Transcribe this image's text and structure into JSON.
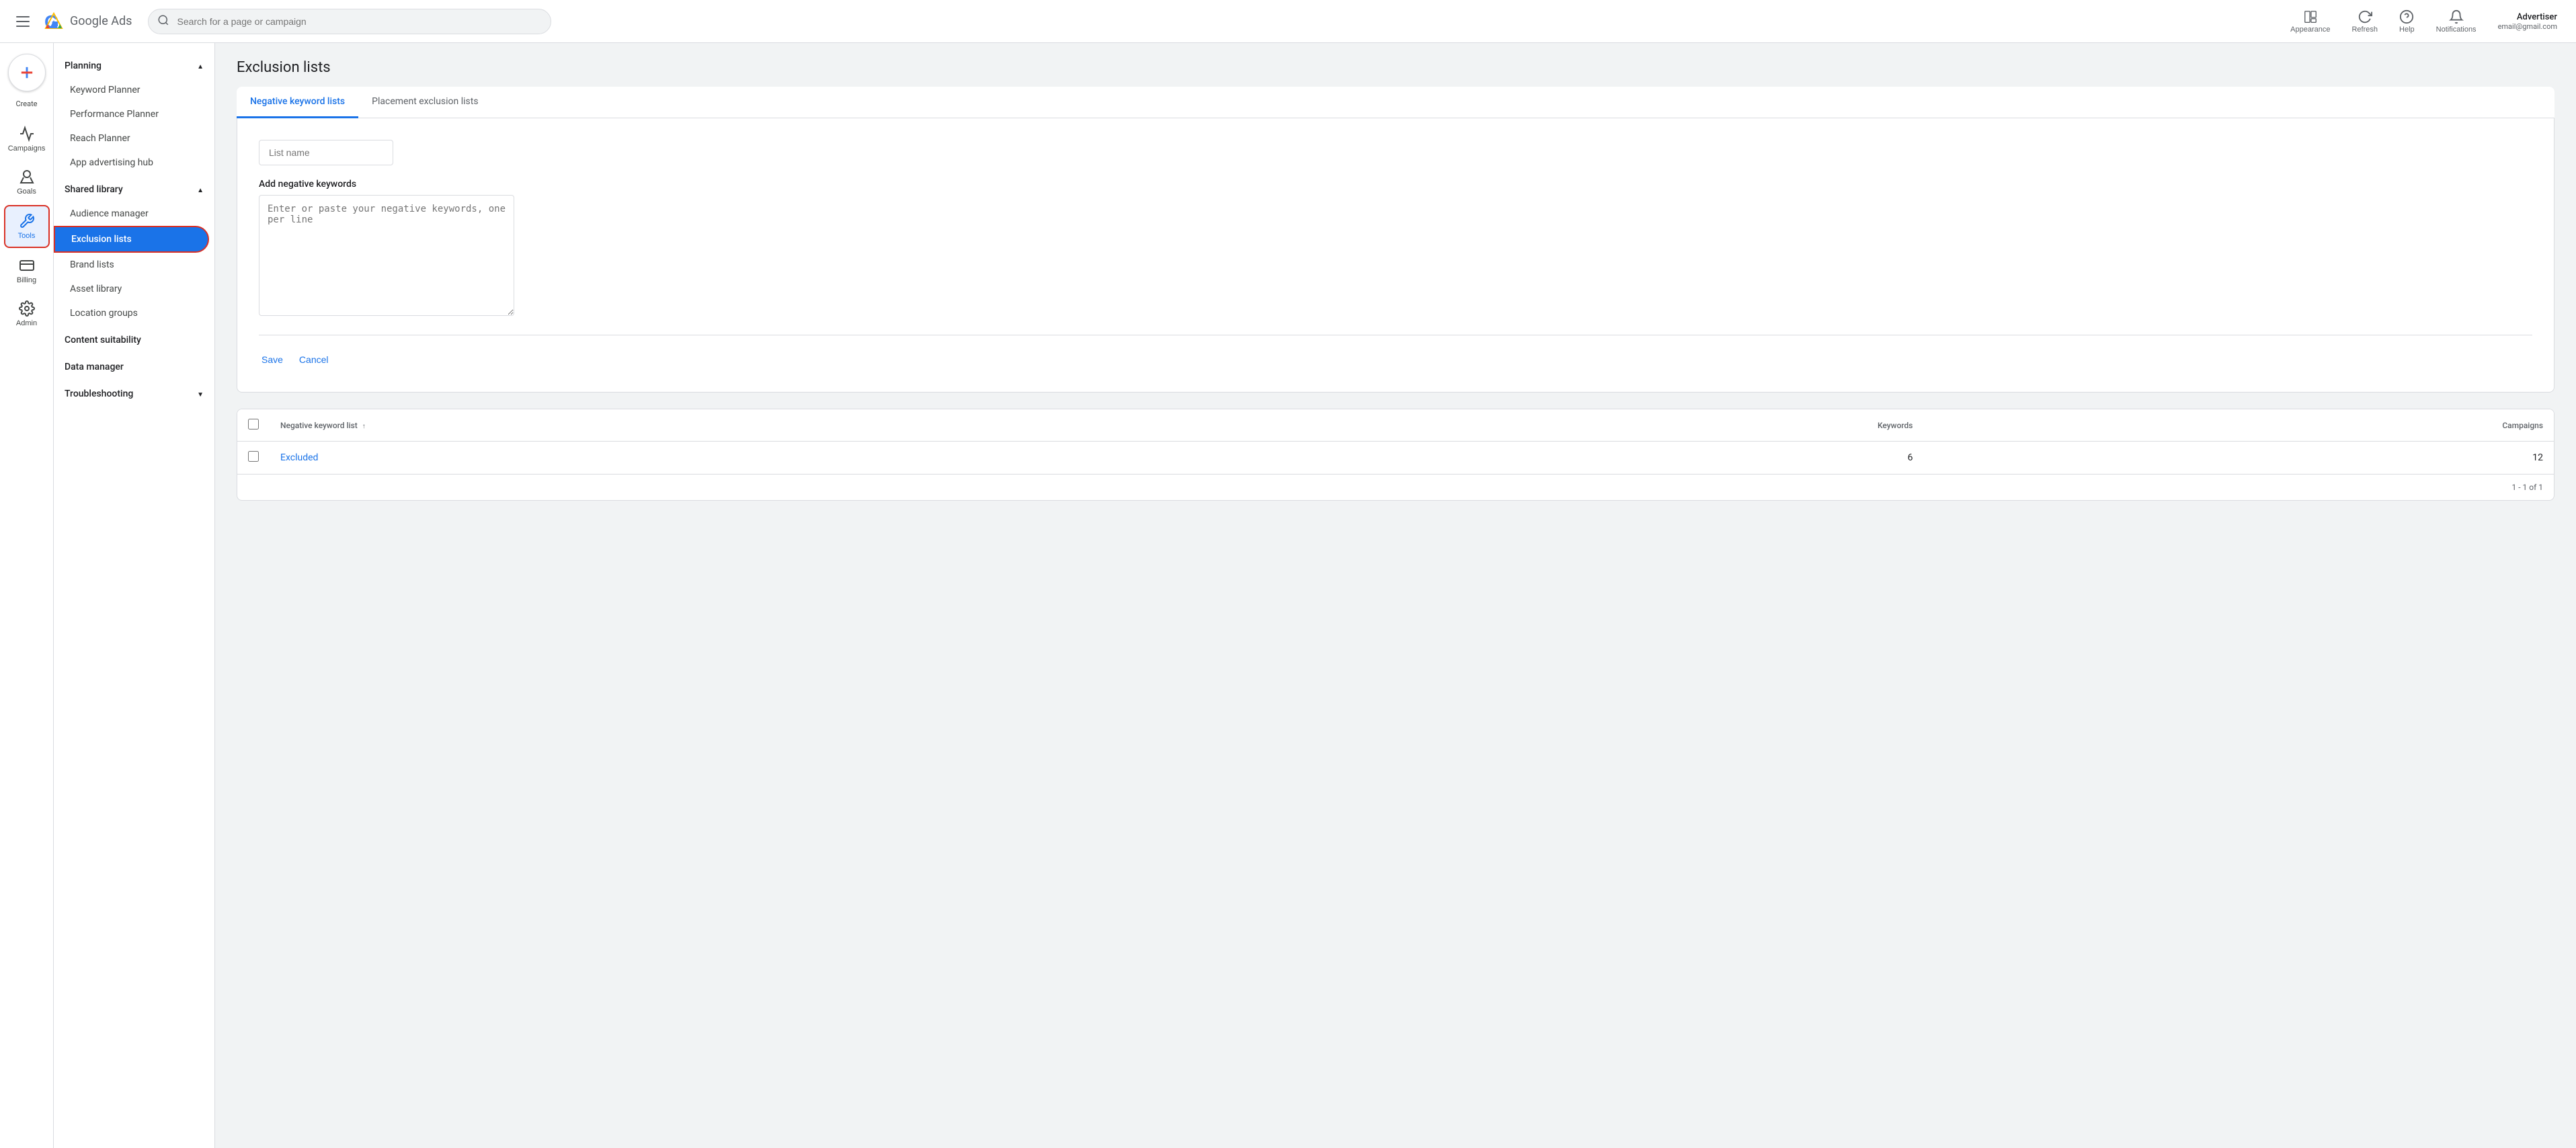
{
  "topbar": {
    "search_placeholder": "Search for a page or campaign",
    "logo_text": "Google Ads",
    "actions": [
      {
        "id": "appearance",
        "label": "Appearance"
      },
      {
        "id": "refresh",
        "label": "Refresh"
      },
      {
        "id": "help",
        "label": "Help"
      },
      {
        "id": "notifications",
        "label": "Notifications"
      }
    ],
    "advertiser_name": "Advertiser",
    "advertiser_email": "email@gmail.com"
  },
  "icon_sidebar": {
    "create_label": "Create",
    "items": [
      {
        "id": "campaigns",
        "label": "Campaigns"
      },
      {
        "id": "goals",
        "label": "Goals"
      },
      {
        "id": "tools",
        "label": "Tools",
        "active": true
      },
      {
        "id": "billing",
        "label": "Billing"
      },
      {
        "id": "admin",
        "label": "Admin"
      }
    ]
  },
  "nav_sidebar": {
    "sections": [
      {
        "id": "planning",
        "label": "Planning",
        "expanded": true,
        "items": [
          {
            "id": "keyword-planner",
            "label": "Keyword Planner"
          },
          {
            "id": "performance-planner",
            "label": "Performance Planner"
          },
          {
            "id": "reach-planner",
            "label": "Reach Planner"
          },
          {
            "id": "app-advertising-hub",
            "label": "App advertising hub"
          }
        ]
      },
      {
        "id": "shared-library",
        "label": "Shared library",
        "expanded": true,
        "items": [
          {
            "id": "audience-manager",
            "label": "Audience manager"
          },
          {
            "id": "exclusion-lists",
            "label": "Exclusion lists",
            "active": true
          },
          {
            "id": "brand-lists",
            "label": "Brand lists"
          },
          {
            "id": "asset-library",
            "label": "Asset library"
          },
          {
            "id": "location-groups",
            "label": "Location groups"
          }
        ]
      },
      {
        "id": "content-suitability",
        "label": "Content suitability",
        "expanded": false,
        "items": []
      },
      {
        "id": "data-manager",
        "label": "Data manager",
        "expanded": false,
        "items": []
      },
      {
        "id": "troubleshooting",
        "label": "Troubleshooting",
        "expanded": false,
        "items": []
      }
    ]
  },
  "main": {
    "page_title": "Exclusion lists",
    "tabs": [
      {
        "id": "negative-keyword-lists",
        "label": "Negative keyword lists",
        "active": true
      },
      {
        "id": "placement-exclusion-lists",
        "label": "Placement exclusion lists",
        "active": false
      }
    ],
    "form": {
      "list_name_placeholder": "List name",
      "add_keywords_label": "Add negative keywords",
      "keywords_placeholder": "Enter or paste your negative keywords, one per line",
      "save_label": "Save",
      "cancel_label": "Cancel"
    },
    "table": {
      "columns": [
        {
          "id": "checkbox",
          "label": ""
        },
        {
          "id": "name",
          "label": "Negative keyword list",
          "sortable": true
        },
        {
          "id": "keywords",
          "label": "Keywords"
        },
        {
          "id": "campaigns",
          "label": "Campaigns"
        }
      ],
      "rows": [
        {
          "id": "excluded",
          "name": "Excluded",
          "keywords": 6,
          "campaigns": 12
        }
      ],
      "pagination": "1 - 1 of 1"
    }
  }
}
